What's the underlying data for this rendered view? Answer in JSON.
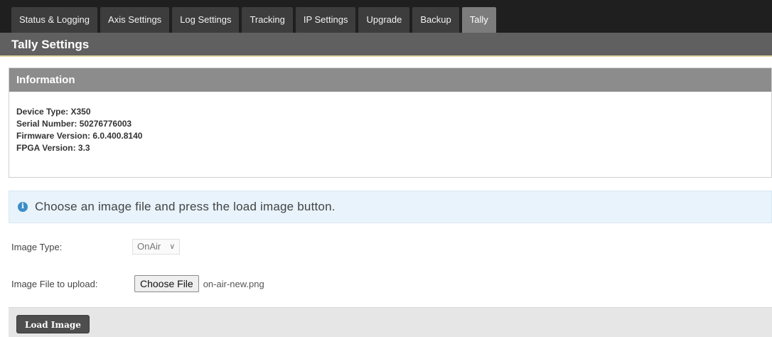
{
  "tabs": [
    {
      "label": "Status & Logging",
      "active": false
    },
    {
      "label": "Axis Settings",
      "active": false
    },
    {
      "label": "Log Settings",
      "active": false
    },
    {
      "label": "Tracking",
      "active": false
    },
    {
      "label": "IP Settings",
      "active": false
    },
    {
      "label": "Upgrade",
      "active": false
    },
    {
      "label": "Backup",
      "active": false
    },
    {
      "label": "Tally",
      "active": true
    }
  ],
  "page_title": "Tally Settings",
  "info": {
    "heading": "Information",
    "lines": [
      "Device Type: X350",
      "Serial Number: 50276776003",
      "Firmware Version: 6.0.400.8140",
      "FPGA Version: 3.3"
    ]
  },
  "alert": {
    "icon": "info-icon",
    "glyph": "i",
    "text": "Choose an image file and press the load image button."
  },
  "form": {
    "image_type_label": "Image Type:",
    "image_type_value": "OnAir",
    "image_file_label": "Image File to upload:",
    "choose_file_label": "Choose File",
    "file_name": "on-air-new.png"
  },
  "footer": {
    "load_button": "Load Image"
  }
}
